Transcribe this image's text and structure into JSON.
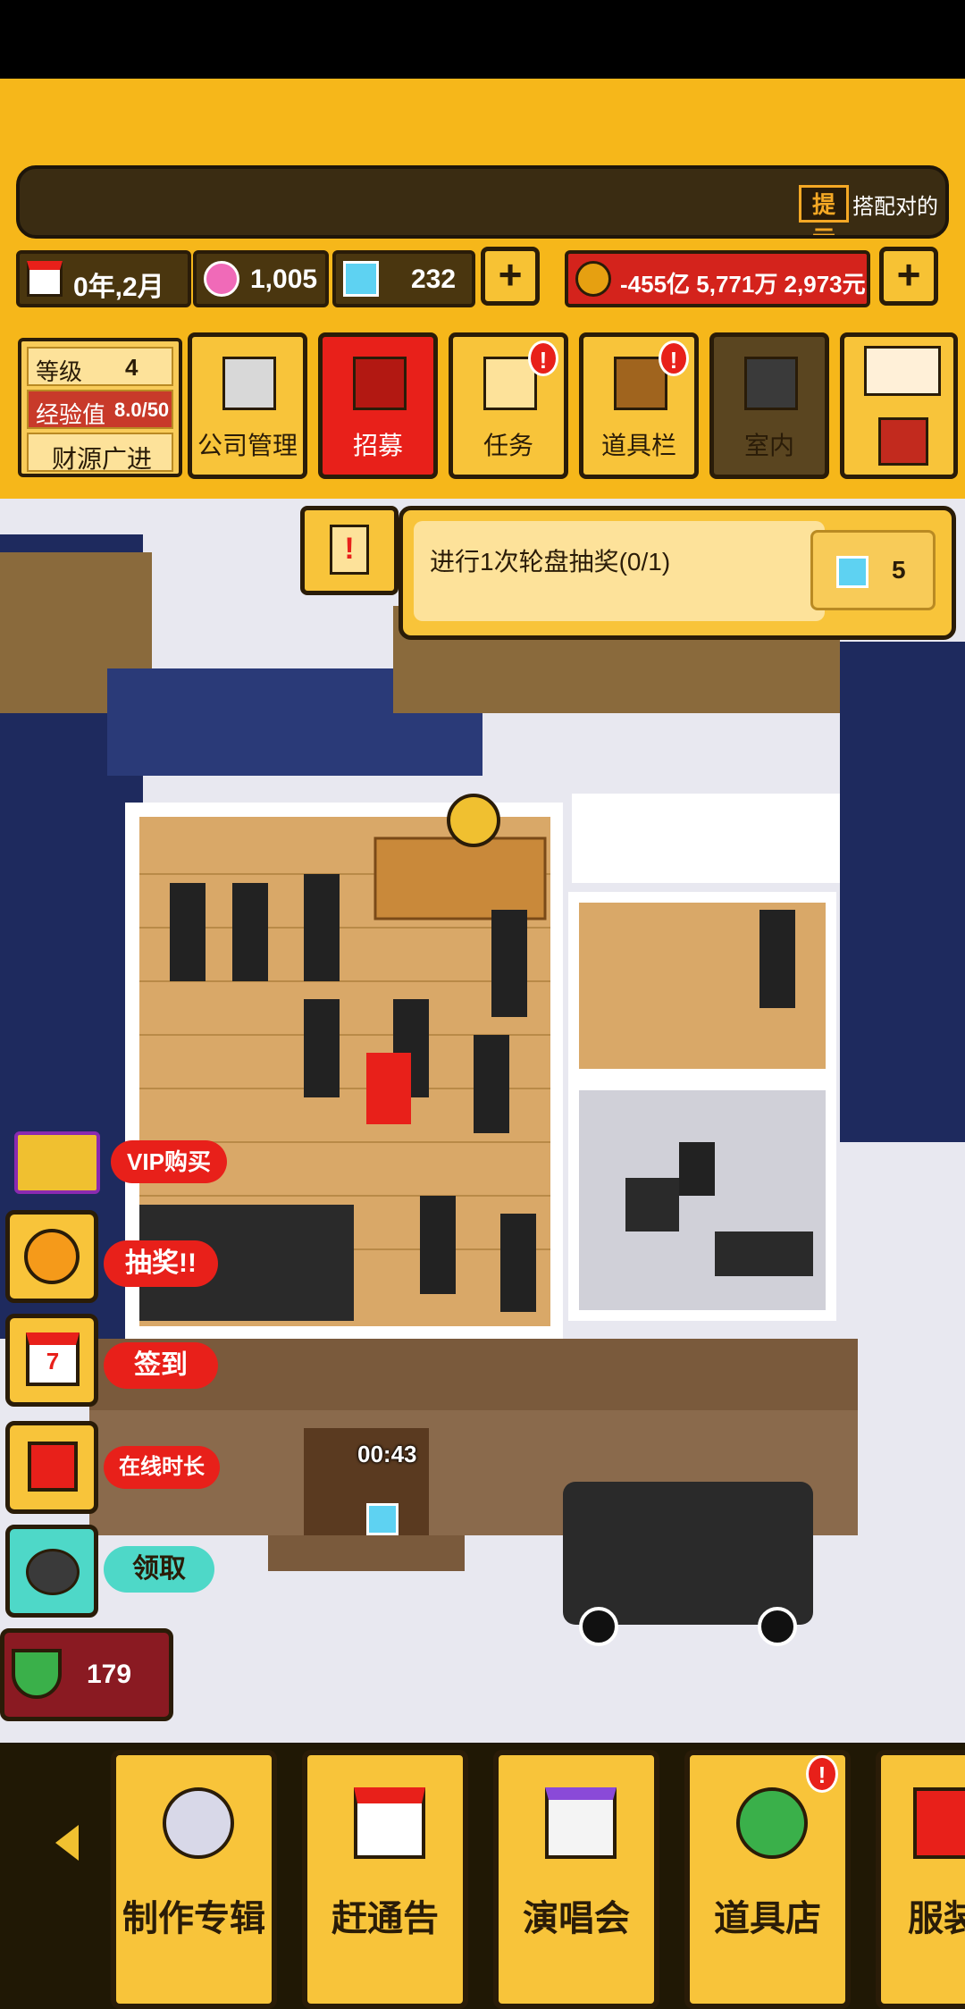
{
  "ticker": {
    "tip_label": "提示",
    "text": "搭配对的"
  },
  "resources": {
    "date": "0年,2月",
    "pink_gems": "1,005",
    "diamonds": "232",
    "money": "-455亿 5,771万 2,973元"
  },
  "level_panel": {
    "level_label": "等级",
    "level_value": "4",
    "exp_label": "经验值",
    "exp_value": "8.0/50",
    "title": "财源广进"
  },
  "menu": [
    {
      "label": "公司管理",
      "badge": ""
    },
    {
      "label": "招募",
      "badge": ""
    },
    {
      "label": "任务",
      "badge": "!"
    },
    {
      "label": "道具栏",
      "badge": "!"
    },
    {
      "label": "室内",
      "badge": ""
    }
  ],
  "quest": {
    "text": "进行1次轮盘抽奖(0/1)",
    "reward": "5"
  },
  "side": {
    "vip": "VIP购买",
    "lottery": "抽奖!!",
    "checkin": "签到",
    "checkin_day": "7",
    "online": "在线时长",
    "claim": "领取",
    "watermelon": "179"
  },
  "timer": "00:43",
  "bottom": [
    {
      "label": "制作专辑",
      "badge": ""
    },
    {
      "label": "赶通告",
      "badge": ""
    },
    {
      "label": "演唱会",
      "badge": ""
    },
    {
      "label": "道具店",
      "badge": "!"
    },
    {
      "label": "服装",
      "badge": ""
    }
  ],
  "colors": {
    "hud_yellow": "#f6b71a",
    "button_yellow": "#f8c43a",
    "alert_red": "#e8201a",
    "dark_outline": "#2a1c08"
  }
}
